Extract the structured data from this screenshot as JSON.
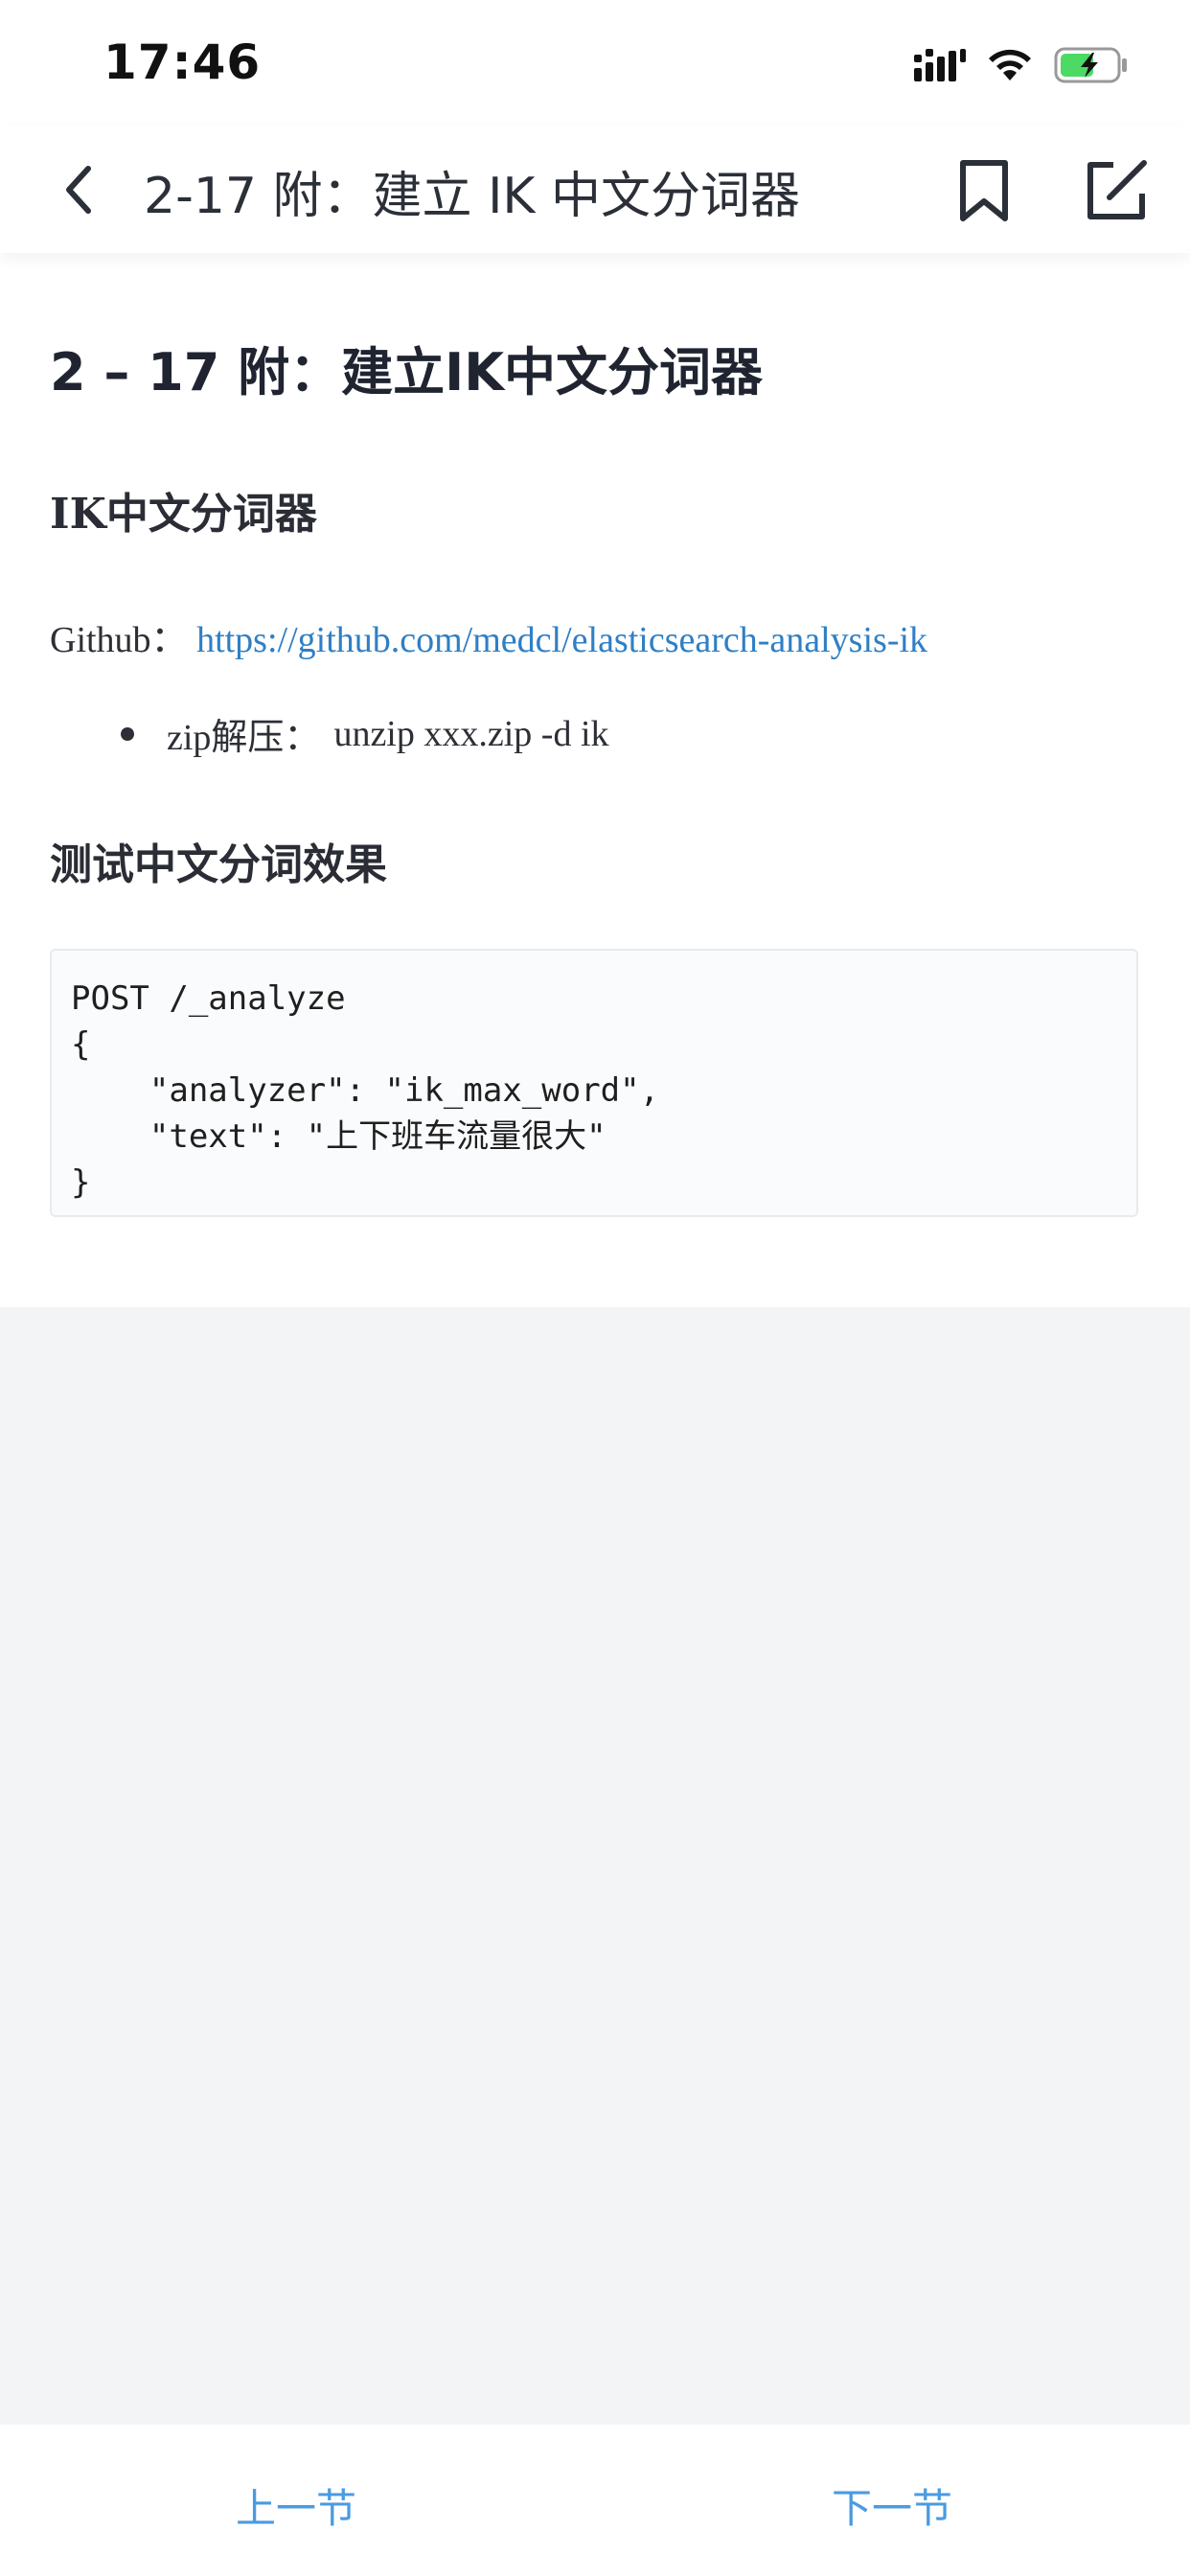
{
  "status_bar": {
    "time": "17:46"
  },
  "nav": {
    "title": "2-17 附：建立 IK 中文分词器"
  },
  "article": {
    "title": "2 – 17 附：建立IK中文分词器",
    "section1_heading": "IK中文分词器",
    "github_label": "Github：",
    "github_link": "https://github.com/medcl/elasticsearch-analysis-ik",
    "bullet_label": "zip解压：",
    "bullet_command": "unzip xxx.zip -d ik",
    "section2_heading": "测试中文分词效果",
    "code": "POST /_analyze\n{\n    \"analyzer\": \"ik_max_word\",\n    \"text\": \"上下班车流量很大\"\n}"
  },
  "footer": {
    "prev_label": "上一节",
    "next_label": "下一节"
  },
  "colors": {
    "link": "#2f7fc4",
    "footer_link": "#4a9be0",
    "battery_fill": "#4cd964"
  },
  "icons": [
    "signal-icon",
    "wifi-icon",
    "battery-charging-icon",
    "back-chevron-icon",
    "bookmark-icon",
    "edit-icon"
  ]
}
